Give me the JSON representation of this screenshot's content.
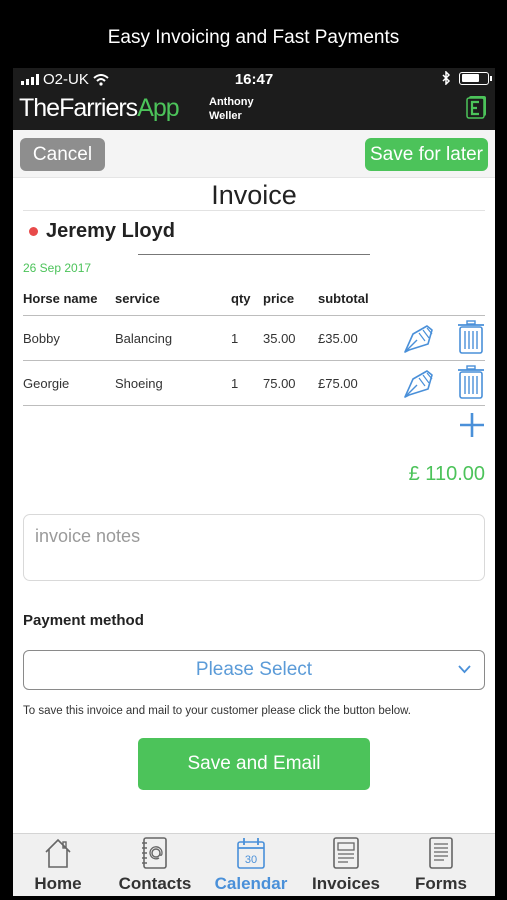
{
  "caption": "Easy Invoicing and Fast Payments",
  "status": {
    "carrier": "O2-UK",
    "time": "16:47"
  },
  "app": {
    "logo_main": "TheFarriers",
    "logo_accent": "App",
    "user_first": "Anthony",
    "user_last": "Weller"
  },
  "toolbar": {
    "cancel_label": "Cancel",
    "save_later_label": "Save for later"
  },
  "invoice": {
    "title": "Invoice",
    "customer": "Jeremy Lloyd",
    "date": "26 Sep 2017",
    "headers": {
      "horse": "Horse name",
      "service": "service",
      "qty": "qty",
      "price": "price",
      "subtotal": "subtotal"
    },
    "rows": [
      {
        "horse": "Bobby",
        "service": "Balancing",
        "qty": "1",
        "price": "35.00",
        "subtotal": "£35.00"
      },
      {
        "horse": "Georgie",
        "service": "Shoeing",
        "qty": "1",
        "price": "75.00",
        "subtotal": "£75.00"
      }
    ],
    "total": "£ 110.00",
    "notes_placeholder": "invoice notes"
  },
  "payment": {
    "label": "Payment method",
    "selected": "Please Select",
    "hint": "To save this invoice and mail to your customer please click the button below.",
    "email_button": "Save and Email"
  },
  "tabs": [
    {
      "label": "Home",
      "icon": "home-icon"
    },
    {
      "label": "Contacts",
      "icon": "contacts-icon"
    },
    {
      "label": "Calendar",
      "icon": "calendar-icon",
      "active": true,
      "calendar_day": "30"
    },
    {
      "label": "Invoices",
      "icon": "invoices-icon"
    },
    {
      "label": "Forms",
      "icon": "forms-icon"
    }
  ],
  "colors": {
    "accent_green": "#4cc35a",
    "accent_blue": "#4a90d9",
    "alert_red": "#e84a4a",
    "cancel_gray": "#8e8e8e"
  }
}
